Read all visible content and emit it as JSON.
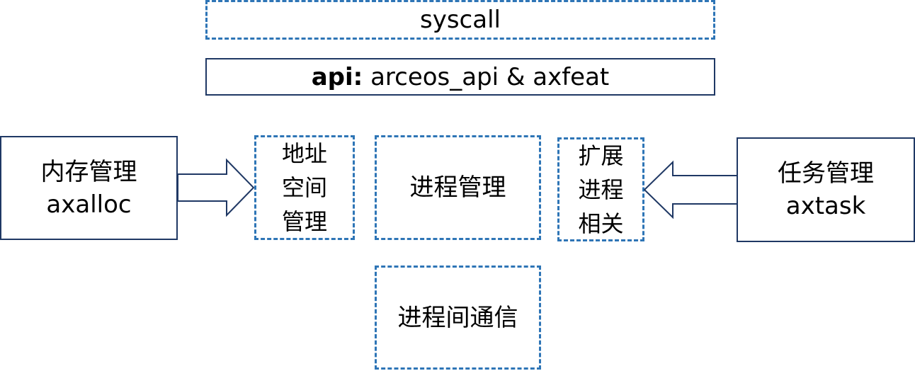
{
  "layers": {
    "syscall": "syscall",
    "api_key": "api:",
    "api_value": " arceos_api & axfeat"
  },
  "modules": {
    "memory": {
      "title": "内存管理",
      "crate": "axalloc"
    },
    "task": {
      "title": "任务管理",
      "crate": "axtask"
    },
    "address_space": "地址\n空间\n管理",
    "process": "进程管理",
    "extended_process": "扩展\n进程\n相关",
    "ipc": "进程间通信"
  },
  "colors": {
    "dashed_border": "#2e75b6",
    "solid_border": "#1f3864",
    "arrow_stroke": "#1f3864",
    "fill": "#ffffff"
  }
}
